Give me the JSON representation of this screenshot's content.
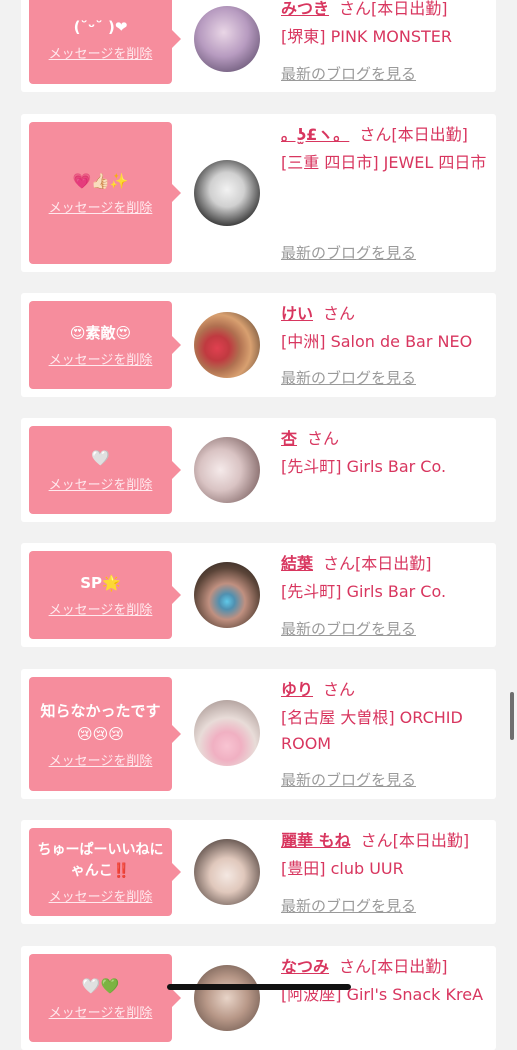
{
  "common": {
    "delete_label": "メッセージを削除",
    "blog_label": "最新のブログを見る",
    "san": "さん"
  },
  "colors": {
    "accent": "#d8365f",
    "bubble": "#f68d9d",
    "background": "#f2f2f2"
  },
  "cards": [
    {
      "message": "(˘ᵕ˘ )❤",
      "name": "みつき",
      "status": "[本日出勤]",
      "shop": "[堺東] PINK MONSTER",
      "avatar_icon": "girl-photo-icon"
    },
    {
      "message": "💗👍🏻✨",
      "name": "。ʖ̫£ヽ。",
      "status": "[本日出勤]",
      "shop": "[三重 四日市] JEWEL 四日市",
      "avatar_icon": "girl-photo-icon"
    },
    {
      "message": "😍素敵😍",
      "name": "けい",
      "status": "",
      "shop": "[中洲] Salon de Bar NEO",
      "avatar_icon": "girl-photo-icon"
    },
    {
      "message": "🤍",
      "name": "杏",
      "status": "",
      "shop": "[先斗町] Girls Bar Co.",
      "avatar_icon": "girl-photo-icon"
    },
    {
      "message": "SP🌟",
      "name": "結葉",
      "status": "[本日出勤]",
      "shop": "[先斗町] Girls Bar Co.",
      "avatar_icon": "girl-photo-icon"
    },
    {
      "message": "知らなかったです😢😢😢",
      "name": "ゆり",
      "status": "",
      "shop": "[名古屋 大曽根] ORCHID ROOM",
      "avatar_icon": "girl-photo-icon"
    },
    {
      "message": "ちゅーぱーいいねにゃんこ‼️",
      "name": "麗華 もね",
      "status": "[本日出勤]",
      "shop": "[豊田] club UUR",
      "avatar_icon": "girl-photo-icon"
    },
    {
      "message": "🤍💚",
      "name": "なつみ",
      "status": "[本日出勤]",
      "shop": "[阿波座] Girl's Snack KreA",
      "avatar_icon": "girl-photo-icon"
    }
  ]
}
